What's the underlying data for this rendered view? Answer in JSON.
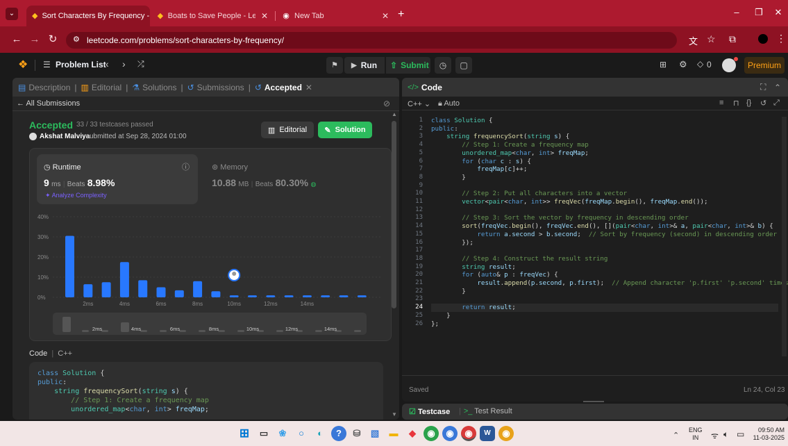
{
  "browser": {
    "tabs": [
      {
        "title": "Sort Characters By Frequency -",
        "active": true
      },
      {
        "title": "Boats to Save People - LeetCod",
        "active": false
      },
      {
        "title": "New Tab",
        "active": false
      }
    ],
    "url": "leetcode.com/problems/sort-characters-by-frequency/"
  },
  "leetcode": {
    "problem_list": "Problem List",
    "run": "Run",
    "submit": "Submit",
    "premium": "Premium",
    "coins": "0"
  },
  "left_tabs": {
    "description": "Description",
    "editorial": "Editorial",
    "solutions": "Solutions",
    "submissions": "Submissions",
    "accepted": "Accepted"
  },
  "submission": {
    "back": "All Submissions",
    "status": "Accepted",
    "passed": "33 / 33 testcases passed",
    "author": "Akshat Malviya",
    "submitted_at": "submitted at Sep 28, 2024 01:00",
    "editorial_btn": "Editorial",
    "solution_btn": "Solution",
    "runtime_label": "Runtime",
    "runtime_value": "9",
    "runtime_unit": "ms",
    "beats_label": "Beats",
    "runtime_beats": "8.98%",
    "analyze": "Analyze Complexity",
    "memory_label": "Memory",
    "memory_value": "10.88",
    "memory_unit": "MB",
    "memory_beats": "80.30%",
    "code_label": "Code",
    "code_lang": "C++"
  },
  "chart_data": {
    "type": "bar",
    "ylim": [
      0,
      40
    ],
    "yticks": [
      "40%",
      "30%",
      "20%",
      "10%",
      "0%"
    ],
    "xticks": [
      "2ms",
      "4ms",
      "6ms",
      "8ms",
      "10ms",
      "12ms",
      "14ms"
    ],
    "values": [
      30.5,
      6.5,
      7.5,
      17.5,
      8.5,
      5,
      3.5,
      8,
      3,
      1,
      1,
      1,
      1,
      1,
      1,
      1,
      1
    ],
    "highlight_index": 9,
    "mini_xticks": [
      "2ms",
      "4ms",
      "6ms",
      "8ms",
      "10ms",
      "12ms",
      "14ms"
    ],
    "mini_values": [
      22,
      3,
      3,
      14,
      3,
      3,
      3,
      3,
      3,
      3,
      3,
      3,
      3,
      3,
      3,
      3
    ]
  },
  "editor": {
    "title": "Code",
    "lang": "C++",
    "mode": "Auto",
    "saved": "Saved",
    "cursor": "Ln 24, Col 23",
    "testcase": "Testcase",
    "test_result": "Test Result"
  },
  "code_lines": [
    "class Solution {",
    "public:",
    "    string frequencySort(string s) {",
    "        // Step 1: Create a frequency map",
    "        unordered_map<char, int> freqMap;",
    "        for (char c : s) {",
    "            freqMap[c]++;",
    "        }",
    "",
    "        // Step 2: Put all characters into a vector",
    "        vector<pair<char, int>> freqVec(freqMap.begin(), freqMap.end());",
    "",
    "        // Step 3: Sort the vector by frequency in descending order",
    "        sort(freqVec.begin(), freqVec.end(), [](pair<char, int>& a, pair<char, int>& b) {",
    "            return a.second > b.second;  // Sort by frequency (second) in descending order",
    "        });",
    "",
    "        // Step 4: Construct the result string",
    "        string result;",
    "        for (auto& p : freqVec) {",
    "            result.append(p.second, p.first);  // Append character 'p.first' 'p.second' times",
    "        }",
    "",
    "        return result;",
    "    }",
    "};"
  ],
  "preview_lines": [
    "class Solution {",
    "public:",
    "    string frequencySort(string s) {",
    "        // Step 1: Create a frequency map",
    "        unordered_map<char, int> freqMap;"
  ],
  "taskbar": {
    "lang": "ENG",
    "region": "IN",
    "time": "09:50 AM",
    "date": "11-03-2025"
  }
}
